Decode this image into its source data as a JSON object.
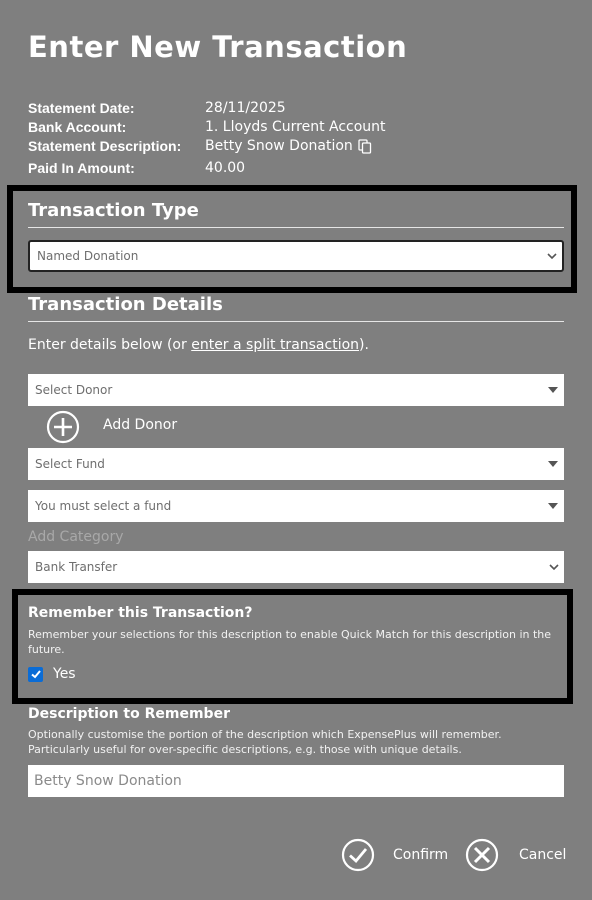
{
  "title": "Enter New Transaction",
  "statement": {
    "date_label": "Statement Date:",
    "date_value": "28/11/2025",
    "account_label": "Bank Account:",
    "account_value": "1. Lloyds Current Account",
    "description_label": "Statement Description:",
    "description_value": "Betty Snow Donation",
    "paid_label": "Paid In Amount:",
    "paid_value": "40.00"
  },
  "transaction_type": {
    "heading": "Transaction Type",
    "selected": "Named Donation"
  },
  "transaction_details": {
    "heading": "Transaction Details",
    "intro_prefix": "Enter details below (or ",
    "intro_link": "enter a split transaction",
    "intro_suffix": ").",
    "donor_select": "Select Donor",
    "add_donor_label": "Add Donor",
    "fund_select": "Select Fund",
    "fund_warning_select": "You must select a fund",
    "add_category_label": "Add Category",
    "payment_method_select": "Bank Transfer"
  },
  "remember": {
    "heading": "Remember this Transaction?",
    "help": "Remember your selections for this description to enable Quick Match for this description in the future.",
    "checkbox_label": "Yes",
    "checked": true
  },
  "description_to_remember": {
    "heading": "Description to Remember",
    "help": "Optionally customise the portion of the description which ExpensePlus will remember. Particularly useful for over-specific descriptions, e.g. those with unique details.",
    "value": "Betty Snow Donation"
  },
  "actions": {
    "confirm_label": "Confirm",
    "cancel_label": "Cancel"
  },
  "colors": {
    "background": "#7f7f7f",
    "checkbox": "#0a6cd6",
    "highlight_border": "#000000"
  }
}
